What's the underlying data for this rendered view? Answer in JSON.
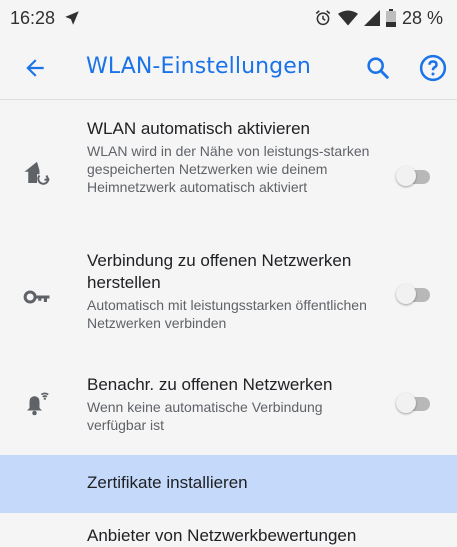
{
  "status_bar": {
    "time": "16:28",
    "battery": "28 %",
    "icons": [
      "navigation-arrow-icon",
      "alarm-icon",
      "wifi-icon",
      "signal-icon",
      "battery-icon"
    ]
  },
  "toolbar": {
    "title": "WLAN-Einstellungen",
    "accent_color": "#1a73e8",
    "icons": [
      "back-arrow-icon",
      "search-icon",
      "help-icon"
    ]
  },
  "settings": [
    {
      "title": "WLAN automatisch aktivieren",
      "subtitle": "WLAN wird in der Nähe von leistungs-starken gespeicherten Netzwerken wie deinem Heimnetzwerk automatisch aktiviert",
      "icon": "home-wifi-icon",
      "enabled": false
    },
    {
      "title": "Verbindung zu offenen Netzwerken herstellen",
      "subtitle": "Automatisch mit leistungsstarken öffentlichen Netzwerken verbinden",
      "icon": "key-icon",
      "enabled": false
    },
    {
      "title": "Benachr. zu offenen Netzwerken",
      "subtitle": "Wenn keine automatische Verbindung verfügbar ist",
      "icon": "notification-wifi-icon",
      "enabled": false
    }
  ],
  "highlighted_item": {
    "label": "Zertifikate installieren",
    "color": "#c5dafb"
  },
  "next_item_partial": {
    "label": "Anbieter von Netzwerkbewertungen"
  }
}
